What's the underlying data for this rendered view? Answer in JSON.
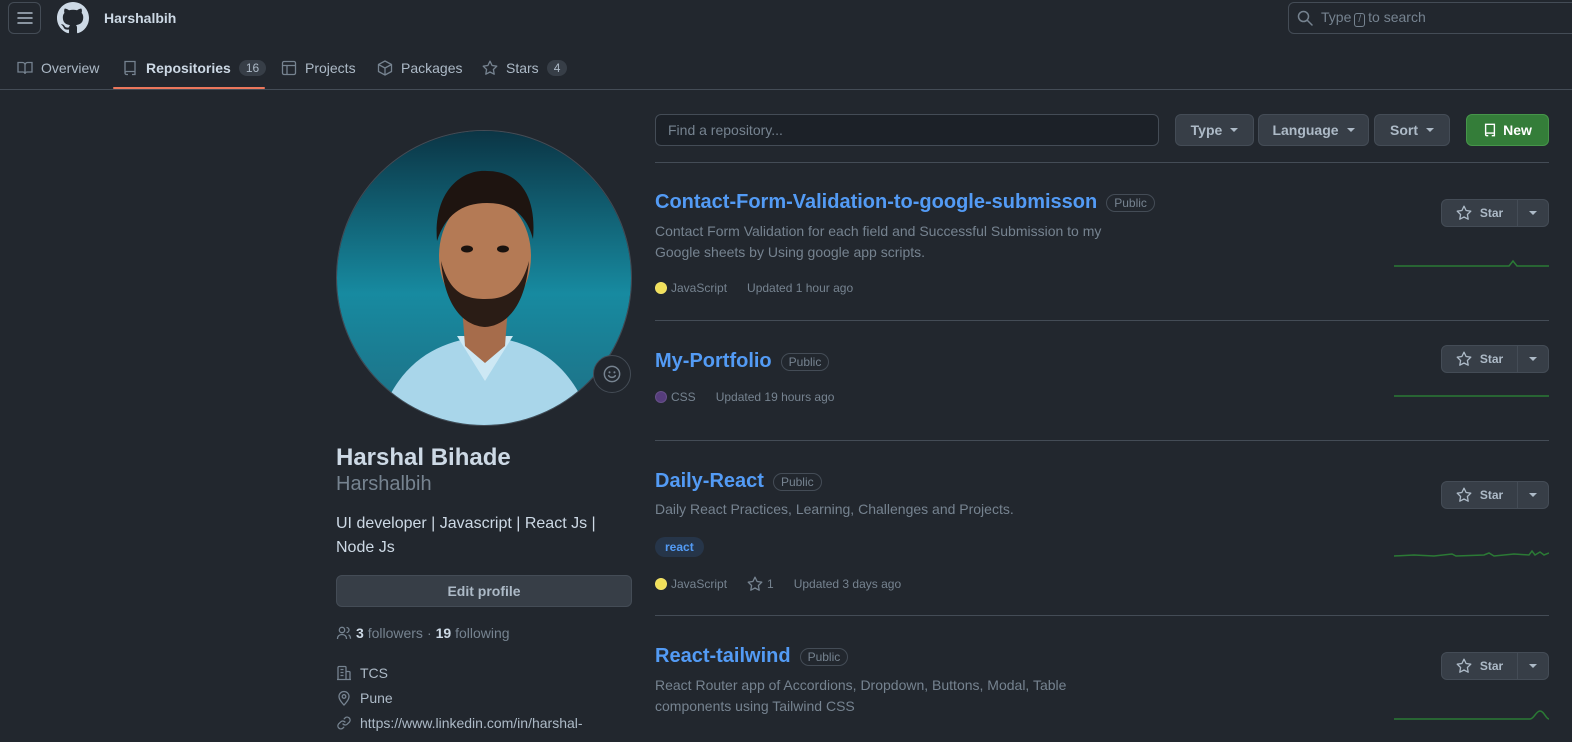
{
  "header": {
    "username": "Harshalbih",
    "search_prefix": "Type",
    "search_key": "/",
    "search_suffix": "to search"
  },
  "tabs": [
    {
      "label": "Overview"
    },
    {
      "label": "Repositories",
      "count": "16"
    },
    {
      "label": "Projects"
    },
    {
      "label": "Packages"
    },
    {
      "label": "Stars",
      "count": "4"
    }
  ],
  "profile": {
    "full_name": "Harshal Bihade",
    "login": "Harshalbih",
    "bio": "UI developer | Javascript | React Js | Node Js",
    "edit_label": "Edit profile",
    "followers_count": "3",
    "followers_label": "followers",
    "separator": "·",
    "following_count": "19",
    "following_label": "following",
    "company": "TCS",
    "location": "Pune",
    "link": "https://www.linkedin.com/in/harshal-"
  },
  "toolbar": {
    "find_placeholder": "Find a repository...",
    "type_label": "Type",
    "language_label": "Language",
    "sort_label": "Sort",
    "new_label": "New"
  },
  "colors": {
    "accent_link": "#539bf5",
    "tab_underline": "#ec775c",
    "new_button": "#347d39",
    "javascript": "#f1e05a",
    "css": "#563d7c"
  },
  "repos": [
    {
      "name": "Contact-Form-Validation-to-google-submisson",
      "visibility": "Public",
      "description": "Contact Form Validation for each field and Successful Submission to my Google sheets by Using google app scripts.",
      "language": "JavaScript",
      "updated": "Updated 1 hour ago",
      "star_label": "Star"
    },
    {
      "name": "My-Portfolio",
      "visibility": "Public",
      "description": "",
      "language": "CSS",
      "updated": "Updated 19 hours ago",
      "star_label": "Star"
    },
    {
      "name": "Daily-React",
      "visibility": "Public",
      "description": "Daily React Practices, Learning, Challenges and Projects.",
      "topic": "react",
      "language": "JavaScript",
      "stars": "1",
      "updated": "Updated 3 days ago",
      "star_label": "Star"
    },
    {
      "name": "React-tailwind",
      "visibility": "Public",
      "description": "React Router app of Accordions, Dropdown, Buttons, Modal, Table components using Tailwind CSS",
      "star_label": "Star"
    }
  ]
}
